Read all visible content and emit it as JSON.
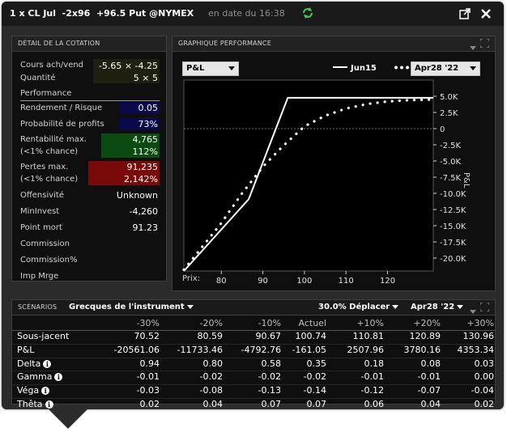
{
  "titlebar": {
    "contract": "1 x CL Jul  -2x96  +96.5 Put @NYMEX",
    "subtitle": "en date du 16:38"
  },
  "quote_panel": {
    "title": "DÉTAIL DE LA COTATION",
    "bid_ask_label": "Cours ach/vend",
    "bid_ask_value": "-5.65 × -4.25",
    "qty_label": "Quantité",
    "qty_value": "5 × 5",
    "section_label": "Performance",
    "rows": {
      "rendement_label": "Rendement / Risque",
      "rendement_value": "0.05",
      "prob_label": "Probabilité de profits",
      "prob_value": "73%",
      "rentmax_label": "Rentabilité max.",
      "rentmax_sub": "(<1% chance)",
      "rentmax_value": "4,765",
      "rentmax_pct": "112%",
      "pertes_label": "Pertes max.",
      "pertes_sub": "(<1% chance)",
      "pertes_value": "91,235",
      "pertes_pct": "2,142%",
      "offensivite_label": "Offensivité",
      "offensivite_value": "Unknown",
      "mininvest_label": "MinInvest",
      "mininvest_value": "-4,260",
      "pointmort_label": "Point mort",
      "pointmort_value": "91.23",
      "commission_label": "Commission",
      "commissionpct_label": "Commission%",
      "impmrge_label": "Imp Mrge"
    },
    "colors": {
      "blue_box": "#0a0a4a",
      "green_box": "#0b4a10",
      "red_box": "#7a0a0a",
      "qty_box": "#202010"
    }
  },
  "chart_panel": {
    "title": "GRAPHIQUE PERFORMANCE",
    "metric_dropdown": "P&L",
    "legend_solid": "Jun15",
    "date_dropdown": "Apr28 '22",
    "xlabel": "Prix:",
    "ylabel": "P&L"
  },
  "chart_data": {
    "type": "line",
    "x_ticks": [
      80,
      90,
      100,
      110,
      120
    ],
    "y_ticks": [
      5000,
      2500,
      0,
      -2500,
      -5000,
      -7500,
      -10000,
      -12500,
      -15000,
      -17500,
      -20000
    ],
    "y_tick_labels": [
      "5.0K",
      "2.5K",
      "0",
      "-2.5K",
      "-5.0K",
      "-7.5K",
      "-10.0K",
      "-12.5K",
      "-15.0K",
      "-17.5K",
      "-20.0K"
    ],
    "xlim": [
      71,
      131
    ],
    "ylim": [
      -22000,
      7500
    ],
    "series": [
      {
        "name": "Jun15",
        "style": "solid",
        "color": "#ffffff",
        "x": [
          71,
          86.6,
          96,
          96.5,
          131
        ],
        "y": [
          -22000,
          -10900,
          4765,
          4765,
          4765
        ]
      },
      {
        "name": "Apr28 '22",
        "style": "dotted",
        "color": "#ffffff",
        "x": [
          71,
          80,
          85,
          90,
          95,
          100,
          105,
          110,
          115,
          120,
          125,
          131
        ],
        "y": [
          -21800,
          -14600,
          -10000,
          -5900,
          -2600,
          350,
          2000,
          3100,
          3800,
          4200,
          4400,
          4500
        ]
      }
    ],
    "grid": false
  },
  "scenarios": {
    "title": "SCÉNARIOS",
    "greeks_dropdown": "Grecques de l'instrument",
    "move_dropdown": "30.0% Déplacer",
    "date_dropdown": "Apr28 '22",
    "columns": [
      "-30%",
      "-20%",
      "-10%",
      "Actuel",
      "+10%",
      "+20%",
      "+30%"
    ],
    "rows": [
      {
        "label": "Sous-jacent",
        "info": false,
        "values": [
          "70.52",
          "80.59",
          "90.67",
          "100.74",
          "110.81",
          "120.89",
          "130.96"
        ]
      },
      {
        "label": "P&L",
        "info": false,
        "values": [
          "-20561.06",
          "-11733.46",
          "-4792.76",
          "-161.05",
          "2507.96",
          "3780.16",
          "4353.34"
        ]
      },
      {
        "label": "Delta",
        "info": true,
        "values": [
          "0.94",
          "0.80",
          "0.58",
          "0.35",
          "0.18",
          "0.08",
          "0.03"
        ]
      },
      {
        "label": "Gamma",
        "info": true,
        "values": [
          "-0.01",
          "-0.02",
          "-0.02",
          "-0.02",
          "-0.01",
          "-0.01",
          "0.00"
        ]
      },
      {
        "label": "Véga",
        "info": true,
        "values": [
          "-0.03",
          "-0.08",
          "-0.13",
          "-0.14",
          "-0.12",
          "-0.07",
          "-0.04"
        ]
      },
      {
        "label": "Thêta",
        "info": true,
        "values": [
          "0.02",
          "0.04",
          "0.07",
          "0.07",
          "0.06",
          "0.04",
          "0.02"
        ]
      }
    ],
    "info_glyph": "i"
  }
}
